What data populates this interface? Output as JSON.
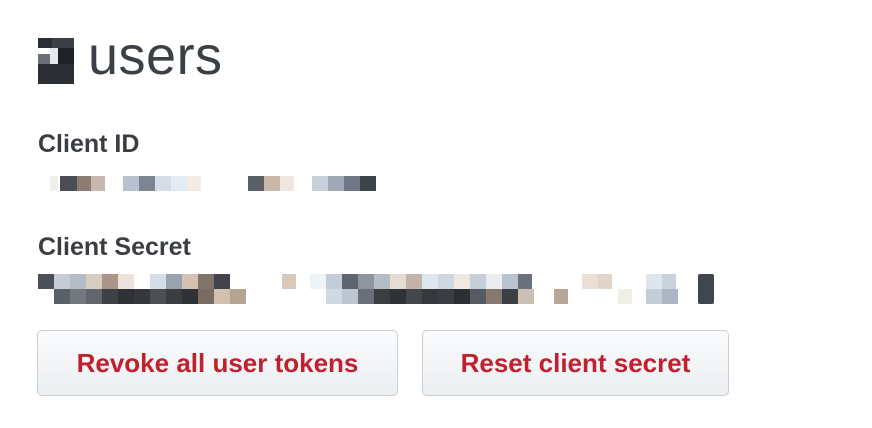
{
  "app": {
    "name": "users",
    "logo_icon": "app-logo-icon"
  },
  "credentials": {
    "client_id_label": "Client ID",
    "client_secret_label": "Client Secret"
  },
  "actions": {
    "revoke_label": "Revoke all user tokens",
    "reset_label": "Reset client secret"
  },
  "colors": {
    "danger_text": "#c21f2f",
    "heading_text": "#3b4046",
    "button_border": "#cbcfd4"
  }
}
